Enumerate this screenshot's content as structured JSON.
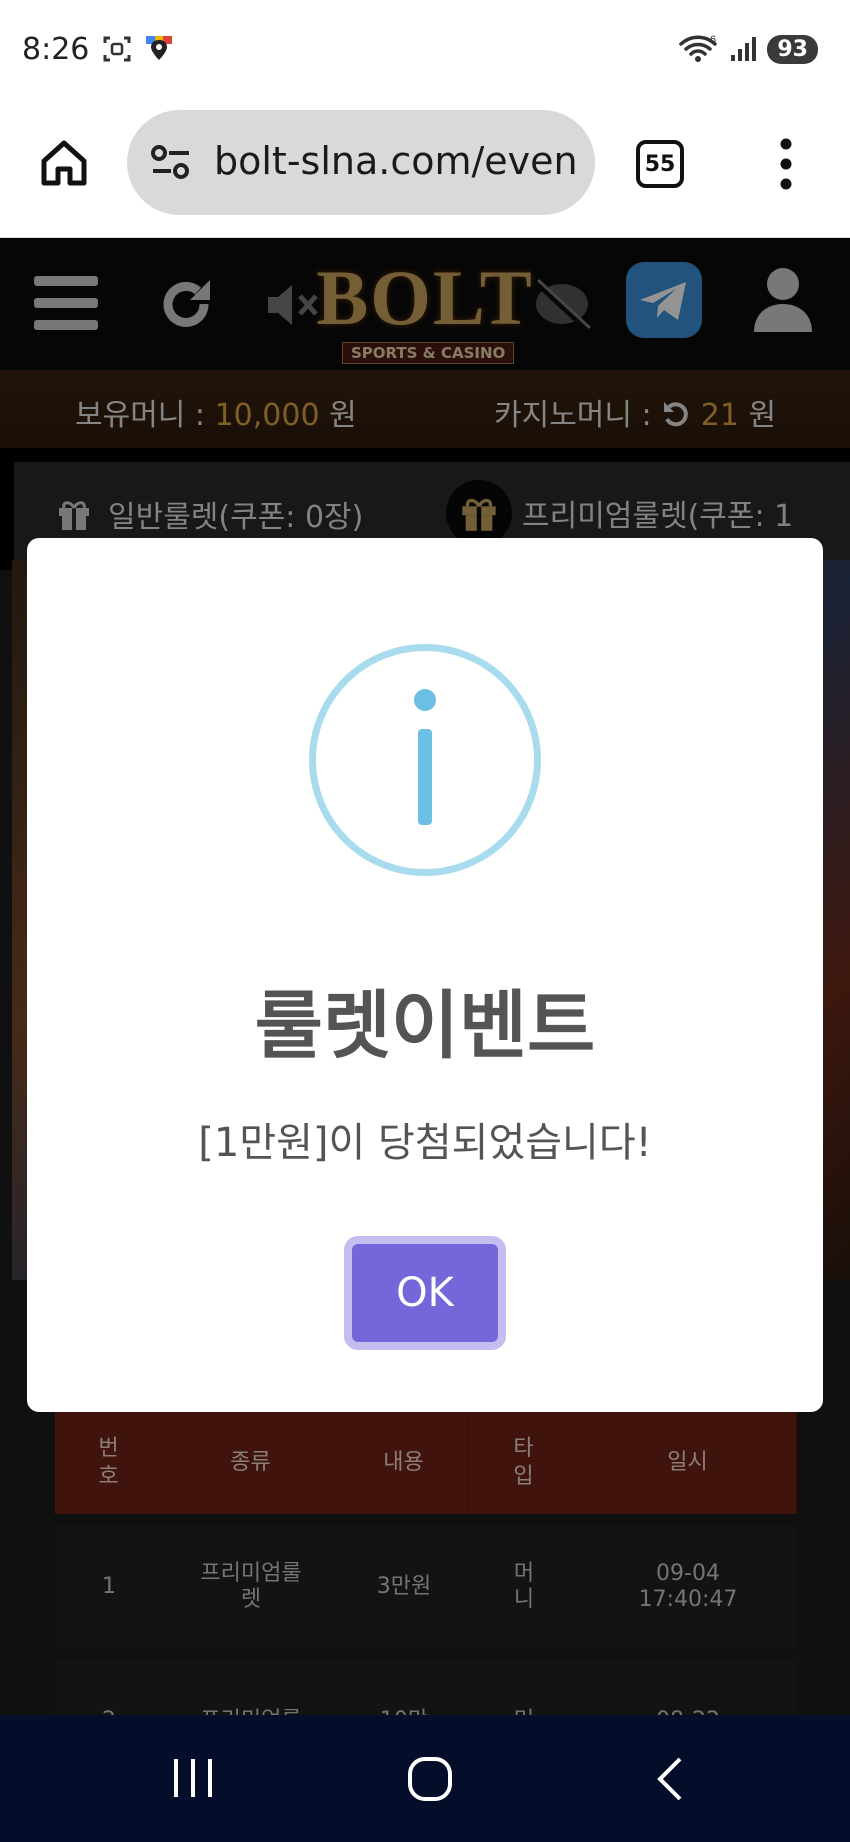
{
  "status_bar": {
    "time": "8:26",
    "battery": "93",
    "wifi_label": "6"
  },
  "browser": {
    "url": "bolt-slna.com/even",
    "tab_count": "55"
  },
  "site_header": {
    "logo_main": "BOLT",
    "logo_sub": "SPORTS & CASINO"
  },
  "balance": {
    "money_label": "보유머니 :",
    "money_value": "10,000",
    "money_unit": "원",
    "casino_label": "카지노머니 :",
    "casino_value": "21",
    "casino_unit": "원"
  },
  "roulette_tabs": {
    "normal": "일반룰렛(쿠폰: 0장)",
    "premium": "프리미엄룰렛(쿠폰: 1"
  },
  "table": {
    "headers": [
      "번\n호",
      "종류",
      "내용",
      "타\n입",
      "일시"
    ],
    "rows": [
      [
        "1",
        "프리미엄룰\n렛",
        "3만원",
        "머\n니",
        "09-04\n17:40:47"
      ],
      [
        "2",
        "프리미엄룰",
        "10만",
        "머",
        "08-22"
      ]
    ]
  },
  "modal": {
    "title": "룰렛이벤트",
    "message": "[1만원]이 당첨되었습니다!",
    "ok_label": "OK"
  },
  "colors": {
    "accent_gold": "#d9a441",
    "ok_button": "#7467d9",
    "info_icon": "#6cc0e5",
    "table_header": "#6e2418"
  }
}
